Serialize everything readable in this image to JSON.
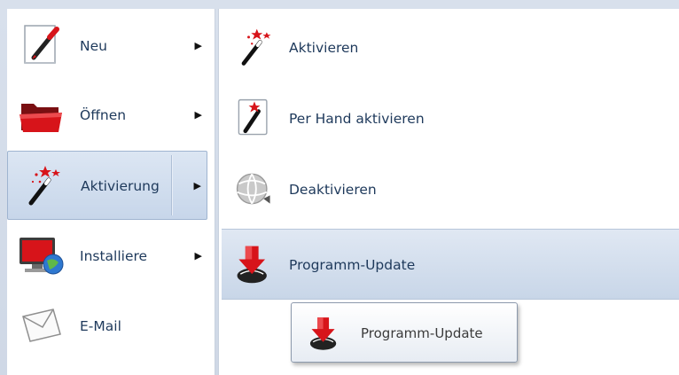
{
  "left_menu": {
    "items": [
      {
        "label": "Neu",
        "icon": "new-document-icon",
        "arrow": "▶"
      },
      {
        "label": "Öffnen",
        "icon": "folder-open-icon",
        "arrow": "▶"
      },
      {
        "label": "Aktivierung",
        "icon": "magic-wand-icon",
        "arrow": "▶"
      },
      {
        "label": "Installiere",
        "icon": "install-monitor-icon",
        "arrow": "▶"
      },
      {
        "label": "E-Mail",
        "icon": "email-envelope-icon"
      }
    ]
  },
  "submenu": {
    "items": [
      {
        "label": "Aktivieren",
        "icon": "magic-wand-icon"
      },
      {
        "label": "Per Hand aktivieren",
        "icon": "manual-activate-icon"
      },
      {
        "label": "Deaktivieren",
        "icon": "deactivate-globe-icon"
      },
      {
        "label": "Programm-Update",
        "icon": "program-update-icon"
      }
    ]
  },
  "tooltip": {
    "label": "Programm-Update",
    "icon": "program-update-icon"
  },
  "colors": {
    "menu_text": "#1e395b",
    "highlight_top": "#dce6f3",
    "highlight_bottom": "#c7d6ea",
    "accent_red": "#d7141a"
  }
}
